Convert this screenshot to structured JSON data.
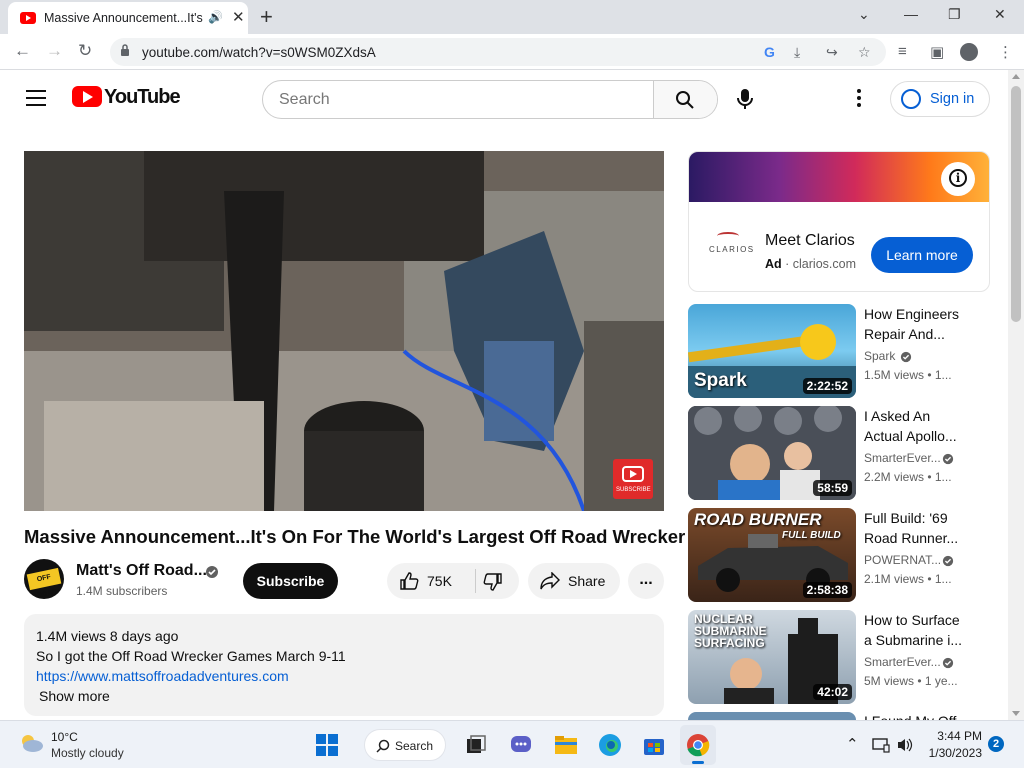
{
  "browser": {
    "tab_title": "Massive Announcement...It's",
    "url": "youtube.com/watch?v=s0WSM0ZXdsA"
  },
  "youtube": {
    "logo_text": "YouTube",
    "search_placeholder": "Search",
    "signin_label": "Sign in"
  },
  "video": {
    "title": "Massive Announcement...It's On For The World's Largest Off Road Wrecker",
    "watermark_text": "SUBSCRIBE",
    "channel_name": "Matt's Off Road...",
    "channel_avatar_text": "OFF ROAD",
    "subscribers": "1.4M subscribers",
    "subscribe_label": "Subscribe",
    "likes": "75K",
    "share_label": "Share",
    "more_label": "...",
    "description": {
      "views_date": "1.4M views  8 days ago",
      "line1": "So I got the Off Road Wrecker Games March 9-11",
      "link": "https://www.mattsoffroadadventures.com",
      "show_more": "Show more"
    }
  },
  "ad": {
    "advertiser": "Meet Clarios",
    "logo_text": "CLARIOS",
    "badge": "Ad",
    "domain": "clarios.com",
    "cta": "Learn more"
  },
  "related": [
    {
      "title_l1": "How Engineers",
      "title_l2": "Repair And...",
      "channel": "Spark",
      "stats": "1.5M views  • 1...",
      "duration": "2:22:52",
      "overlay": "Spark"
    },
    {
      "title_l1": "I Asked An",
      "title_l2": "Actual Apollo...",
      "channel": "SmarterEver...",
      "stats": "2.2M views  • 1...",
      "duration": "58:59",
      "overlay": ""
    },
    {
      "title_l1": "Full Build: '69",
      "title_l2": "Road Runner...",
      "channel": "POWERNAT...",
      "stats": "2.1M views  • 1...",
      "duration": "2:58:38",
      "overlay": "ROAD BURNER",
      "overlay2": "FULL BUILD"
    },
    {
      "title_l1": "How to Surface",
      "title_l2": "a Submarine i...",
      "channel": "SmarterEver...",
      "stats": "5M views  • 1 ye...",
      "duration": "42:02",
      "overlay": "NUCLEAR",
      "overlay2": "SUBMARINE",
      "overlay3": "SURFACING"
    },
    {
      "title_l1": "I Found My Off",
      "title_l2": "",
      "channel": "",
      "stats": "",
      "duration": "",
      "overlay": ""
    }
  ],
  "taskbar": {
    "temperature": "10°C",
    "condition": "Mostly cloudy",
    "search_label": "Search",
    "time": "3:44 PM",
    "date": "1/30/2023",
    "notifications": "2"
  }
}
